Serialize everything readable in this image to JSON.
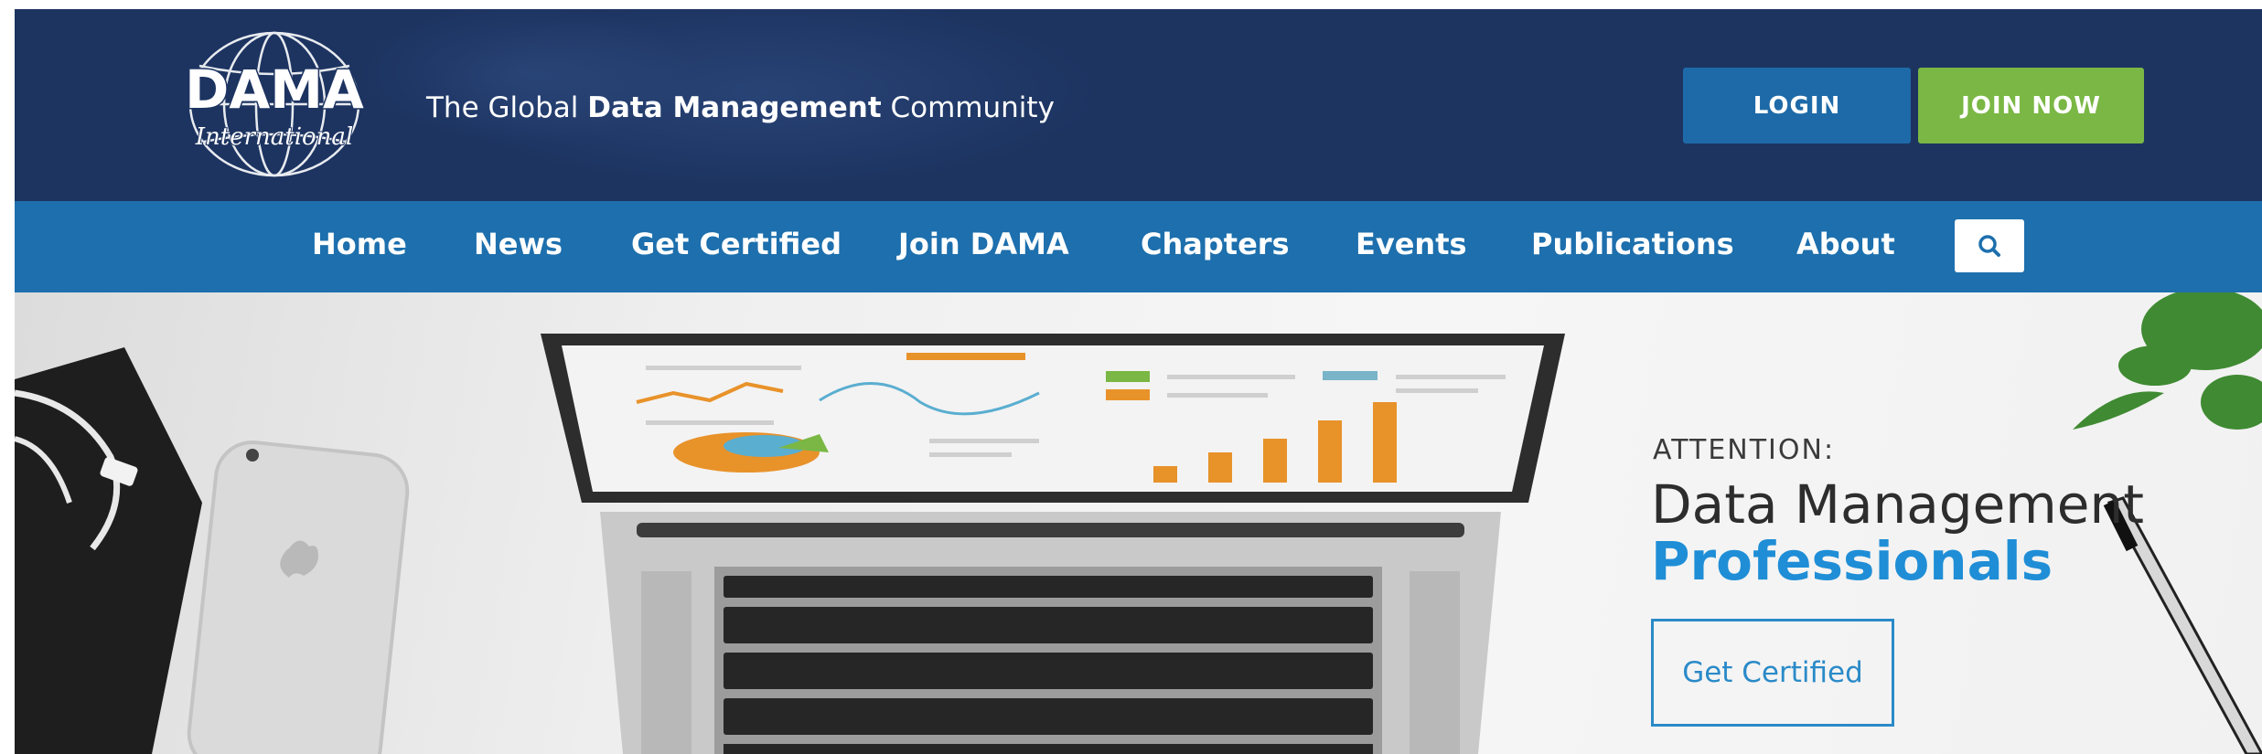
{
  "header": {
    "logo_text": "DAMA",
    "logo_subtext": "International",
    "tagline_pre": "The Global ",
    "tagline_bold": "Data Management",
    "tagline_post": " Community",
    "login_label": "LOGIN",
    "join_label": "JOIN NOW"
  },
  "nav": {
    "items": [
      {
        "label": "Home"
      },
      {
        "label": "News"
      },
      {
        "label": "Get Certified"
      },
      {
        "label": "Join DAMA"
      },
      {
        "label": "Chapters"
      },
      {
        "label": "Events"
      },
      {
        "label": "Publications"
      },
      {
        "label": "About"
      }
    ],
    "search_icon": "search-icon"
  },
  "hero": {
    "attention": "ATTENTION:",
    "headline_line1": "Data Management",
    "headline_line2": "Professionals",
    "cta_label": "Get Certified"
  },
  "colors": {
    "header_bg": "#1d3461",
    "nav_bg": "#1d6fad",
    "login_bg": "#1e6aa8",
    "join_bg": "#7ab744",
    "accent_blue": "#1f8ed6",
    "chart_orange": "#e8922a"
  }
}
